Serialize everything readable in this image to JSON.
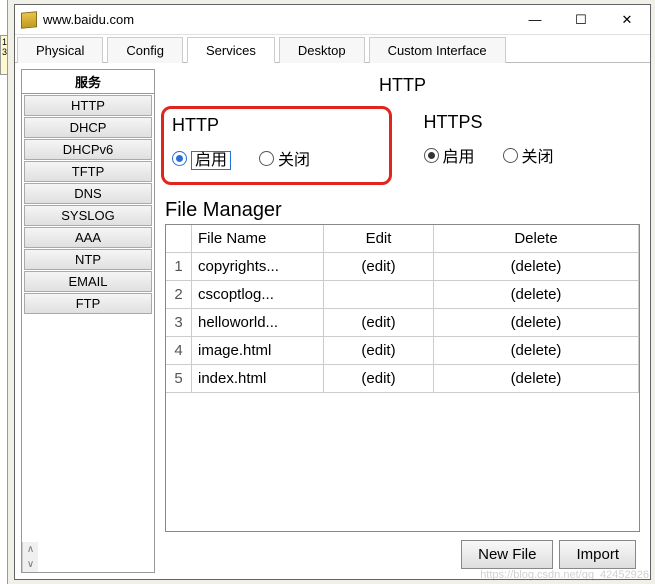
{
  "window": {
    "title": "www.baidu.com"
  },
  "tabs": [
    "Physical",
    "Config",
    "Services",
    "Desktop",
    "Custom Interface"
  ],
  "active_tab": 2,
  "sidebar": {
    "header": "服务",
    "items": [
      "HTTP",
      "DHCP",
      "DHCPv6",
      "TFTP",
      "DNS",
      "SYSLOG",
      "AAA",
      "NTP",
      "EMAIL",
      "FTP"
    ]
  },
  "page": {
    "title": "HTTP",
    "http": {
      "label": "HTTP",
      "on": "启用",
      "off": "关闭",
      "value": "on"
    },
    "https": {
      "label": "HTTPS",
      "on": "启用",
      "off": "关闭",
      "value": "on"
    }
  },
  "file_manager": {
    "title": "File Manager",
    "cols": {
      "name": "File Name",
      "edit": "Edit",
      "del": "Delete"
    },
    "rows": [
      {
        "idx": "1",
        "name": "copyrights...",
        "edit": "(edit)",
        "del": "(delete)"
      },
      {
        "idx": "2",
        "name": "cscoptlog...",
        "edit": "",
        "del": "(delete)"
      },
      {
        "idx": "3",
        "name": "helloworld...",
        "edit": "(edit)",
        "del": "(delete)"
      },
      {
        "idx": "4",
        "name": "image.html",
        "edit": "(edit)",
        "del": "(delete)"
      },
      {
        "idx": "5",
        "name": "index.html",
        "edit": "(edit)",
        "del": "(delete)"
      }
    ]
  },
  "buttons": {
    "newfile": "New File",
    "import": "Import"
  },
  "watermark": "https://blog.csdn.net/qq_42452926",
  "bg_nums": "1\n3"
}
